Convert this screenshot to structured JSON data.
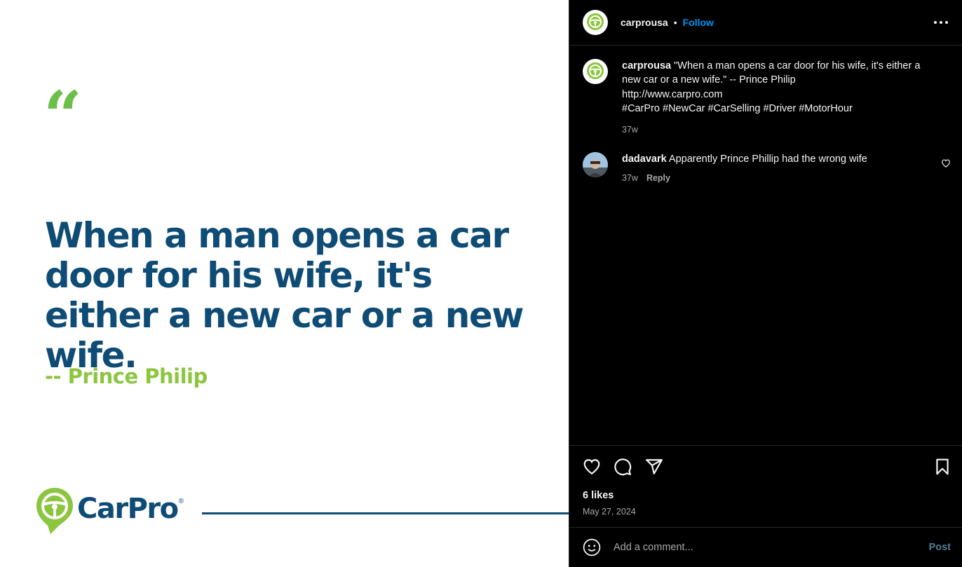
{
  "post_image": {
    "quote_mark": "“",
    "quote_text": "When a man opens a car door for his wife, it's either a new car or a new wife.",
    "author": "-- Prince Philip",
    "brand": "CarPro",
    "brand_reg": "®",
    "colors": {
      "navy": "#0f4c75",
      "green": "#8cc63f",
      "quote_green": "#6cc04a"
    }
  },
  "header": {
    "username": "carprousa",
    "separator": "•",
    "follow_label": "Follow",
    "more_icon": "more-horizontal-icon"
  },
  "caption": {
    "username": "carprousa",
    "text": "\"When a man opens a car door for his wife, it's either a new car or a new wife.\" -- Prince Philip",
    "link": "http://www.carpro.com",
    "hashtags": "#CarPro #NewCar #CarSelling #Driver #MotorHour",
    "age": "37w"
  },
  "comments": [
    {
      "username": "dadavark",
      "text": "Apparently Prince Phillip had the wrong wife",
      "age": "37w",
      "reply_label": "Reply"
    }
  ],
  "actions": {
    "like_icon": "heart-icon",
    "comment_icon": "comment-icon",
    "share_icon": "send-icon",
    "save_icon": "bookmark-icon",
    "likes": "6 likes",
    "date": "May 27, 2024"
  },
  "comment_bar": {
    "emoji_icon": "emoji-icon",
    "placeholder": "Add a comment...",
    "post_label": "Post"
  }
}
